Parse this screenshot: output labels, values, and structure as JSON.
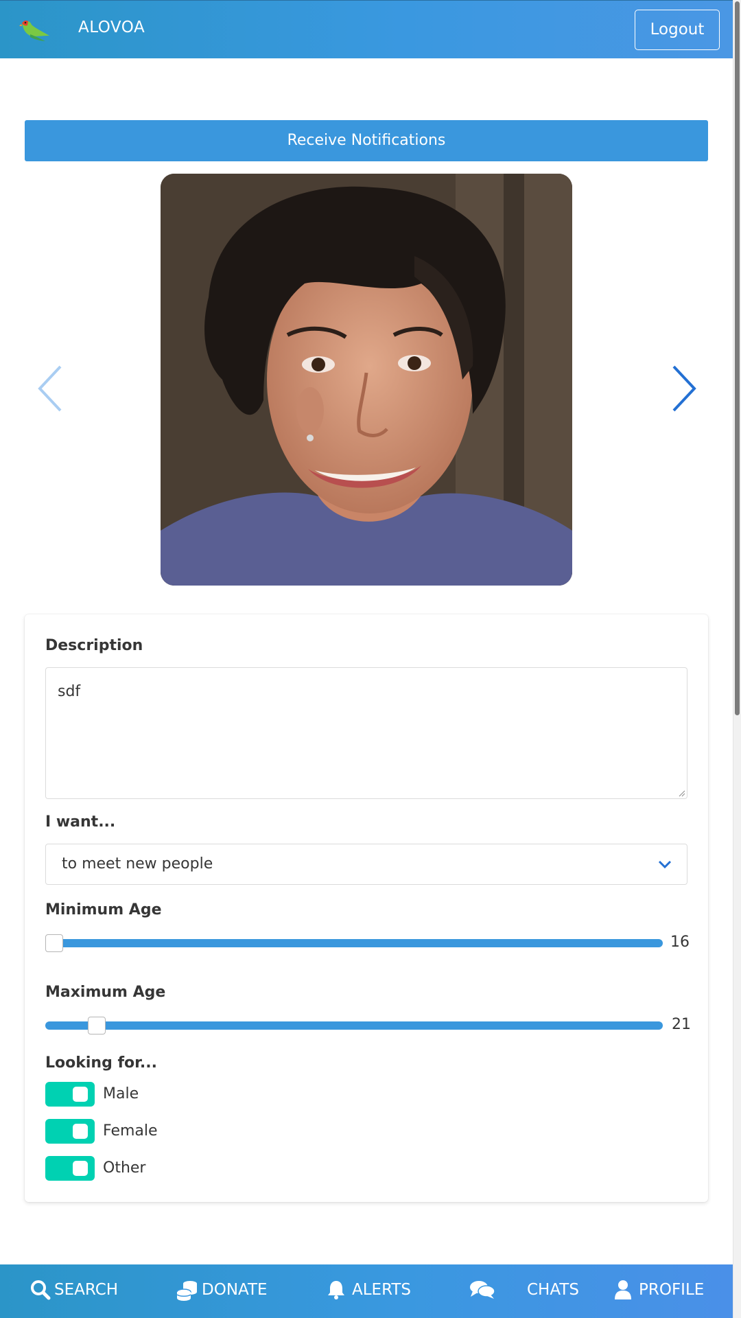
{
  "header": {
    "brand": "ALOVOA",
    "logout_label": "Logout"
  },
  "notifications": {
    "button_label": "Receive Notifications"
  },
  "gallery": {
    "prev_icon": "chevron-left-icon",
    "next_icon": "chevron-right-icon"
  },
  "profile": {
    "description": {
      "label": "Description",
      "value": "sdf"
    },
    "intention": {
      "label": "I want...",
      "selected": "to meet new people"
    },
    "min_age": {
      "label": "Minimum Age",
      "value": "16",
      "fraction": 0.0
    },
    "max_age": {
      "label": "Maximum Age",
      "value": "21",
      "fraction": 0.071
    },
    "looking_for": {
      "label": "Looking for...",
      "options": [
        {
          "label": "Male",
          "checked": true
        },
        {
          "label": "Female",
          "checked": true
        },
        {
          "label": "Other",
          "checked": true
        }
      ]
    }
  },
  "bottom_nav": {
    "items": [
      {
        "label": "SEARCH",
        "icon": "search-icon"
      },
      {
        "label": "DONATE",
        "icon": "coins-icon"
      },
      {
        "label": "ALERTS",
        "icon": "bell-icon"
      },
      {
        "label": "CHATS",
        "icon": "chat-bubbles-icon"
      },
      {
        "label": "PROFILE",
        "icon": "user-icon"
      }
    ]
  },
  "colors": {
    "primary": "#3a97dd",
    "switch_on": "#00d1b2",
    "text": "#363636"
  }
}
